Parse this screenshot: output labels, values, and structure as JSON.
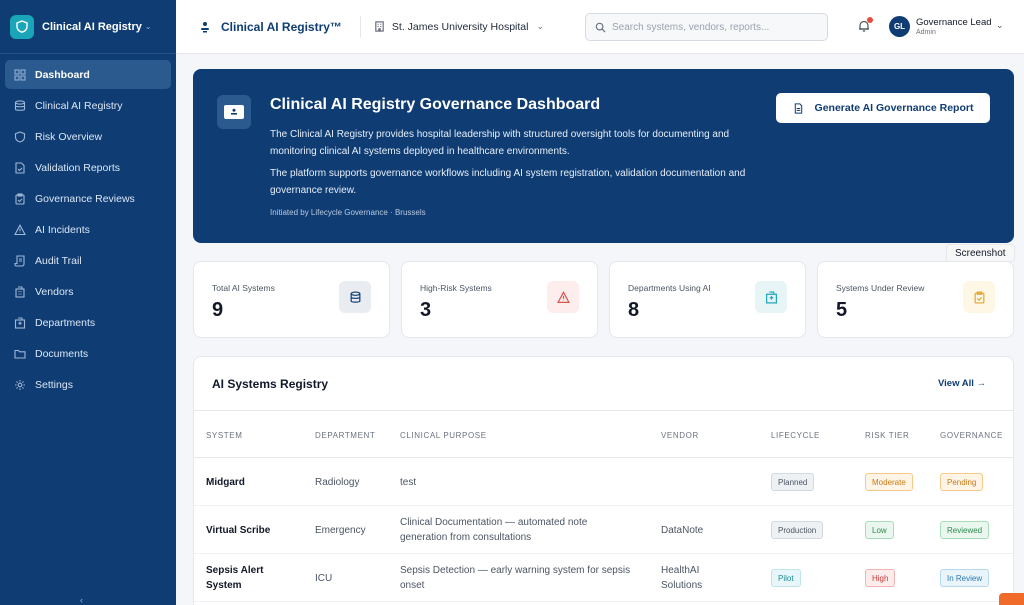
{
  "brand": {
    "title": "Clinical AI Registry"
  },
  "sidebar": {
    "items": [
      {
        "label": "Dashboard",
        "icon": "grid-icon",
        "active": true
      },
      {
        "label": "Clinical AI Registry",
        "icon": "database-icon"
      },
      {
        "label": "Risk Overview",
        "icon": "shield-icon"
      },
      {
        "label": "Validation Reports",
        "icon": "file-check-icon"
      },
      {
        "label": "Governance Reviews",
        "icon": "clipboard-check-icon"
      },
      {
        "label": "AI Incidents",
        "icon": "warning-icon"
      },
      {
        "label": "Audit Trail",
        "icon": "scroll-icon"
      },
      {
        "label": "Vendors",
        "icon": "building-icon"
      },
      {
        "label": "Departments",
        "icon": "hospital-icon"
      },
      {
        "label": "Documents",
        "icon": "folder-icon"
      },
      {
        "label": "Settings",
        "icon": "gear-icon"
      }
    ]
  },
  "topbar": {
    "title": "Clinical AI Registry™",
    "hospital": "St. James University Hospital",
    "search_placeholder": "Search systems, vendors, reports...",
    "user_initials": "GL",
    "user_name": "Governance Lead",
    "user_role": "Admin"
  },
  "hero": {
    "title": "Clinical AI Registry Governance Dashboard",
    "p1": "The Clinical AI Registry provides hospital leadership with structured oversight tools for documenting and monitoring clinical AI systems deployed in healthcare environments.",
    "p2": "The platform supports governance workflows including AI system registration, validation documentation and governance review.",
    "note": "Initiated by Lifecycle Governance · Brussels",
    "button": "Generate AI Governance Report"
  },
  "tooltip": "Screenshot",
  "stats": [
    {
      "label": "Total AI Systems",
      "value": "9",
      "icon": "database-icon"
    },
    {
      "label": "High-Risk Systems",
      "value": "3",
      "icon": "warning-icon"
    },
    {
      "label": "Departments Using AI",
      "value": "8",
      "icon": "hospital-icon"
    },
    {
      "label": "Systems Under Review",
      "value": "5",
      "icon": "clipboard-icon"
    }
  ],
  "registry": {
    "title": "AI Systems Registry",
    "view_all": "View All →",
    "columns": [
      "SYSTEM",
      "DEPARTMENT",
      "CLINICAL PURPOSE",
      "VENDOR",
      "LIFECYCLE",
      "RISK TIER",
      "GOVERNANCE"
    ],
    "rows": [
      {
        "system": "Midgard",
        "department": "Radiology",
        "purpose": "test",
        "vendor": "",
        "lifecycle": "Planned",
        "risk": "Moderate",
        "governance": "Pending"
      },
      {
        "system": "Virtual Scribe",
        "department": "Emergency",
        "purpose": "Clinical Documentation — automated note generation from consultations",
        "vendor": "DataNote",
        "lifecycle": "Production",
        "risk": "Low",
        "governance": "Reviewed"
      },
      {
        "system": "Sepsis Alert System",
        "department": "ICU",
        "purpose": "Sepsis Detection — early warning system for sepsis onset",
        "vendor": "HealthAI Solutions",
        "lifecycle": "Pilot",
        "risk": "High",
        "governance": "In Review"
      }
    ]
  },
  "colors": {
    "primary": "#0f3d73",
    "accent": "#1aa5b8"
  }
}
